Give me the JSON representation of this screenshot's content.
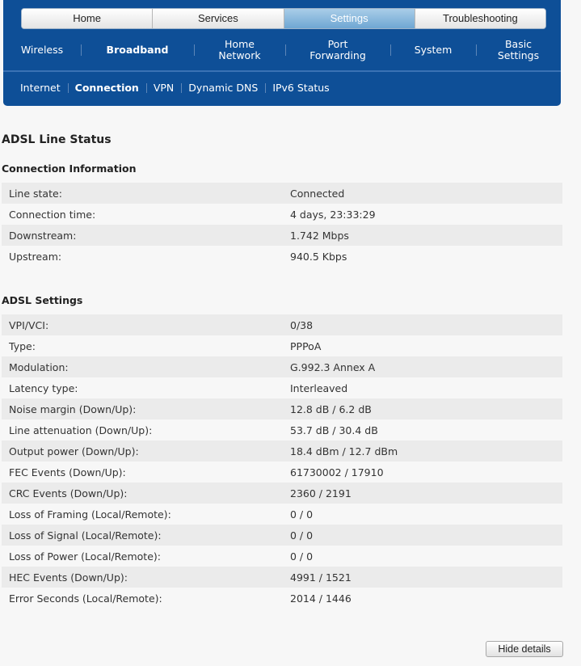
{
  "main_tabs": [
    {
      "label": "Home",
      "active": false
    },
    {
      "label": "Services",
      "active": false
    },
    {
      "label": "Settings",
      "active": true
    },
    {
      "label": "Troubleshooting",
      "active": false
    }
  ],
  "sub_nav": [
    {
      "label": "Wireless"
    },
    {
      "label": "Broadband"
    },
    {
      "label": "Home\nNetwork"
    },
    {
      "label": "Port\nForwarding"
    },
    {
      "label": "System"
    },
    {
      "label": "Basic\nSettings"
    }
  ],
  "third_nav": [
    {
      "label": "Internet"
    },
    {
      "label": "Connection"
    },
    {
      "label": "VPN"
    },
    {
      "label": "Dynamic DNS"
    },
    {
      "label": "IPv6 Status"
    }
  ],
  "page": {
    "title": "ADSL Line Status",
    "hide_details_label": "Hide details"
  },
  "connection_info": {
    "title": "Connection Information",
    "rows": [
      {
        "label": "Line state:",
        "value": "Connected"
      },
      {
        "label": "Connection time:",
        "value": "4 days, 23:33:29"
      },
      {
        "label": "Downstream:",
        "value": "1.742 Mbps"
      },
      {
        "label": "Upstream:",
        "value": "940.5 Kbps"
      }
    ]
  },
  "adsl_settings": {
    "title": "ADSL Settings",
    "rows": [
      {
        "label": "VPI/VCI:",
        "value": "0/38"
      },
      {
        "label": "Type:",
        "value": "PPPoA"
      },
      {
        "label": "Modulation:",
        "value": "G.992.3 Annex A"
      },
      {
        "label": "Latency type:",
        "value": "Interleaved"
      },
      {
        "label": "Noise margin (Down/Up):",
        "value": "12.8 dB / 6.2 dB"
      },
      {
        "label": "Line attenuation (Down/Up):",
        "value": "53.7 dB / 30.4 dB"
      },
      {
        "label": "Output power (Down/Up):",
        "value": "18.4 dBm / 12.7 dBm"
      },
      {
        "label": "FEC Events (Down/Up):",
        "value": "61730002 / 17910"
      },
      {
        "label": "CRC Events (Down/Up):",
        "value": "2360 / 2191"
      },
      {
        "label": "Loss of Framing (Local/Remote):",
        "value": "0 / 0"
      },
      {
        "label": "Loss of Signal (Local/Remote):",
        "value": "0 / 0"
      },
      {
        "label": "Loss of Power (Local/Remote):",
        "value": "0 / 0"
      },
      {
        "label": "HEC Events (Down/Up):",
        "value": "4991 / 1521"
      },
      {
        "label": "Error Seconds (Local/Remote):",
        "value": "2014 / 1446"
      }
    ]
  },
  "colors": {
    "header_bg": "#0e4f97",
    "active_tab": "#7fb2da"
  }
}
